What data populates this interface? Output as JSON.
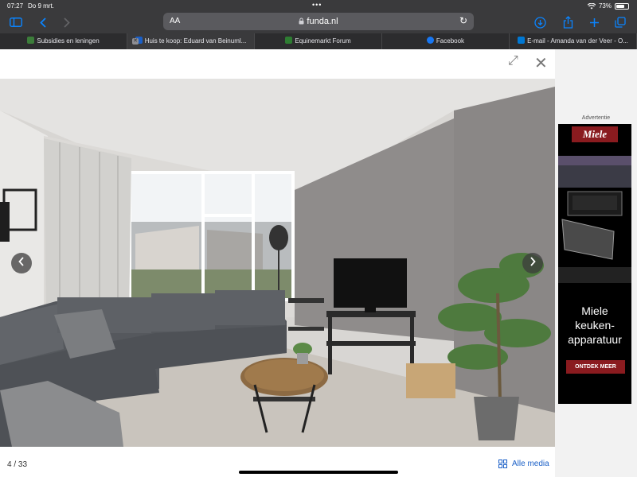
{
  "status_bar": {
    "time": "07:27",
    "date": "Do 9 mrt.",
    "battery": "73%",
    "battery_level": 0.73
  },
  "address_bar": {
    "text_size_label": "AA",
    "url": "funda.nl"
  },
  "tabs": [
    {
      "label": "Subsidies en leningen",
      "favicon_color": "#3c7d3a"
    },
    {
      "label": "Huis te koop: Eduard van Beinuml...",
      "favicon_color": "#1a5fc7",
      "active": true
    },
    {
      "label": "Equinemarkt Forum",
      "favicon_color": "#2e7d32"
    },
    {
      "label": "Facebook",
      "favicon_color": "#1877f2"
    },
    {
      "label": "E-mail - Amanda van der Veer - O...",
      "favicon_color": "#0078d4"
    }
  ],
  "gallery": {
    "counter": "4 / 33",
    "all_media_label": "Alle media"
  },
  "ad": {
    "label": "Advertentie",
    "brand": "Miele",
    "headline_lines": [
      "Miele",
      "keuken-",
      "apparatuur"
    ],
    "cta": "ONTDEK MEER",
    "brand_color": "#8a1b1f"
  }
}
